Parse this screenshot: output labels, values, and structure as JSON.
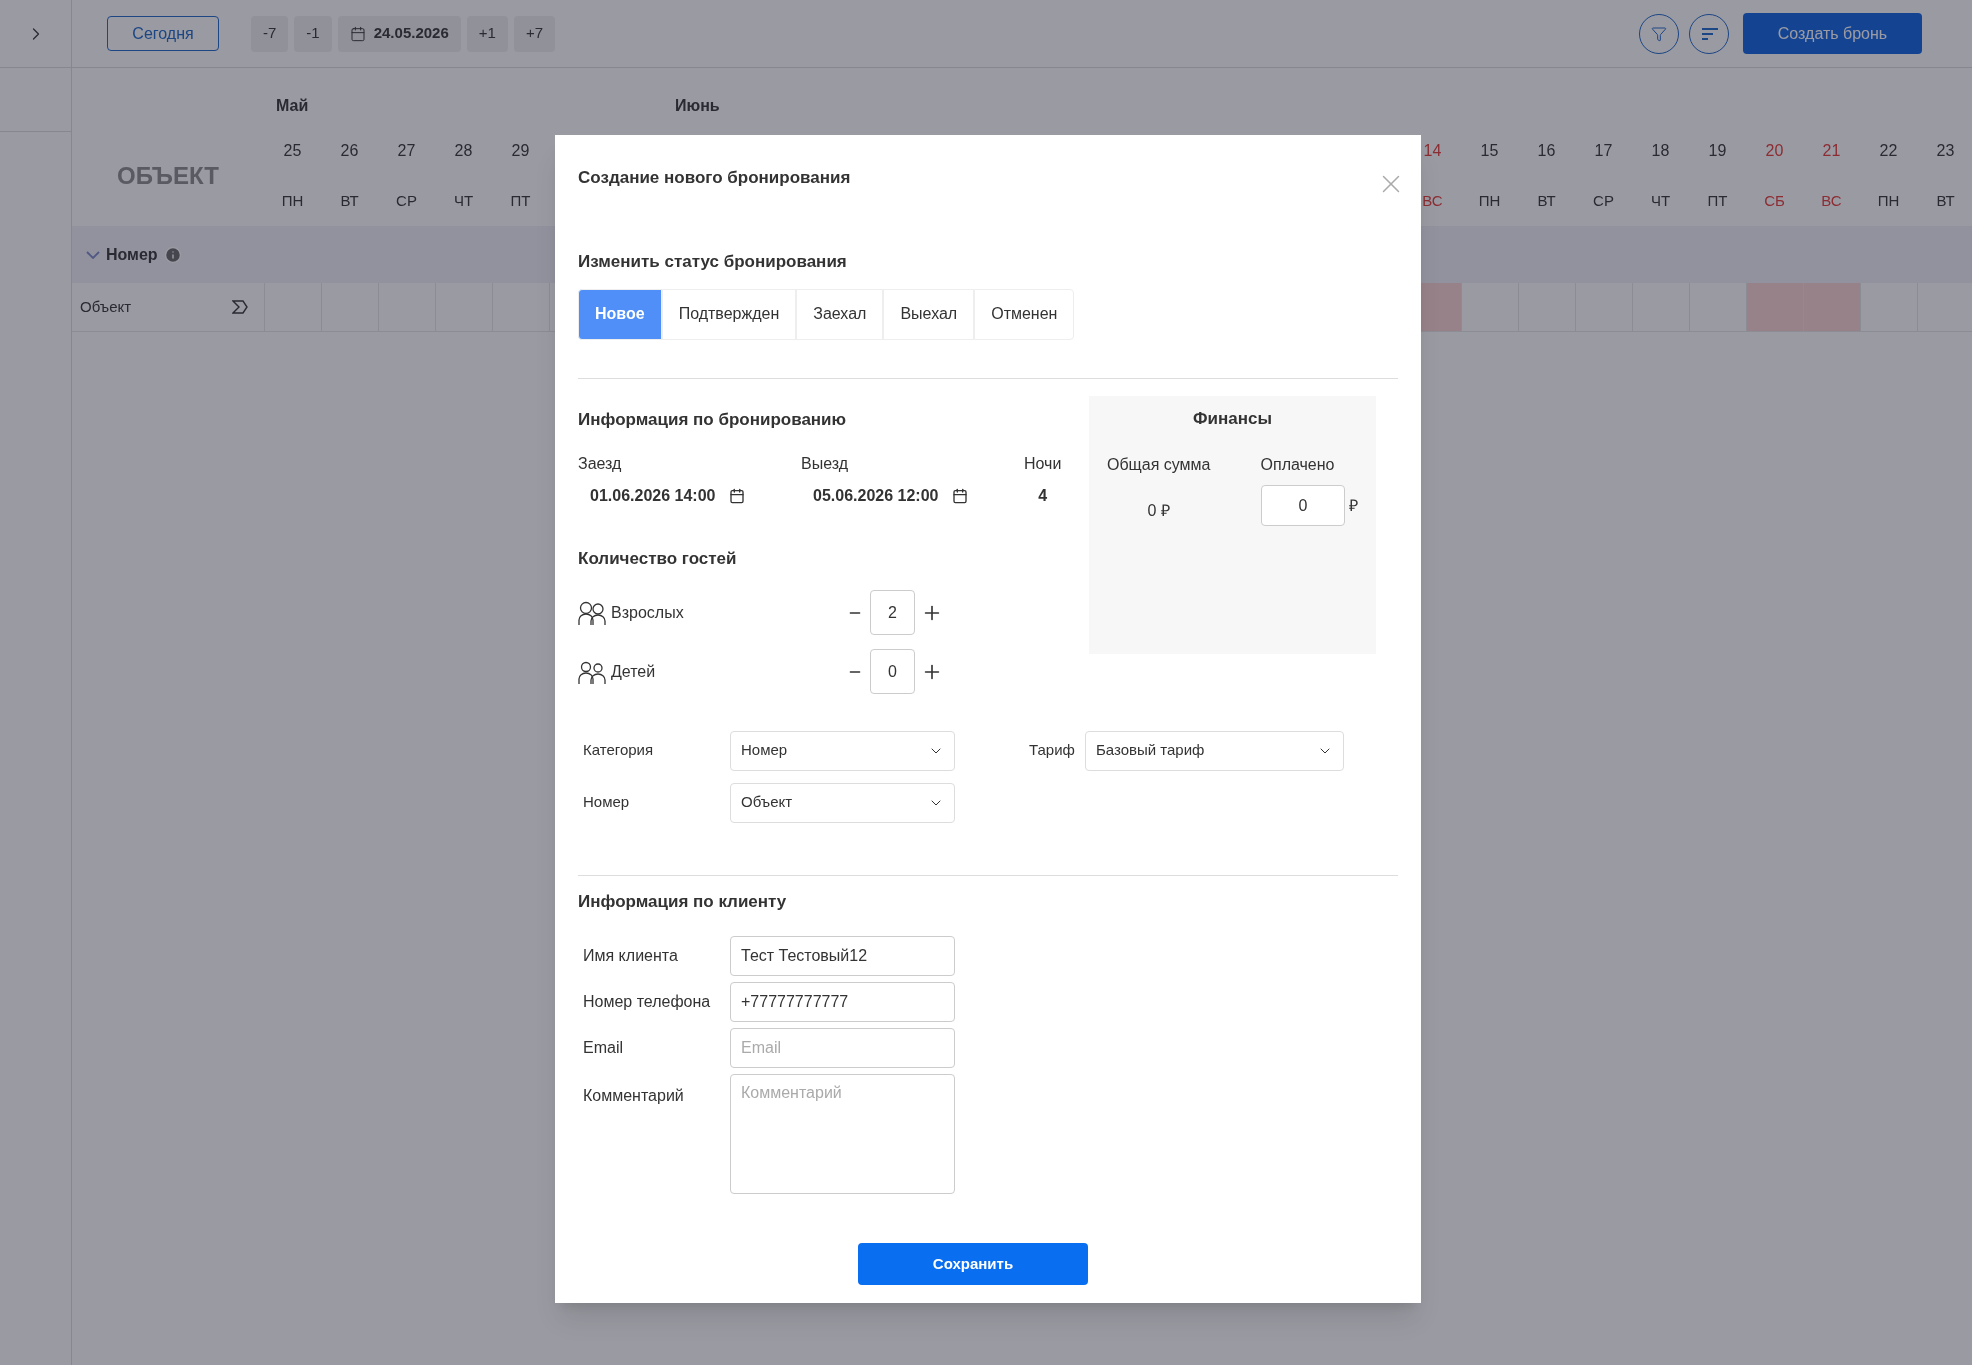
{
  "toolbar": {
    "today_button": "Сегодня",
    "steps_before": [
      "-7",
      "-1"
    ],
    "date": "24.05.2026",
    "steps_after": [
      "+1",
      "+7"
    ],
    "create_button": "Создать бронь"
  },
  "calendar": {
    "object_heading": "ОБЪЕКТ",
    "months": [
      "Май",
      "Июнь"
    ],
    "left_days": [
      {
        "day": "25",
        "weekday": "ПН",
        "weekend": false
      },
      {
        "day": "26",
        "weekday": "ВТ",
        "weekend": false
      },
      {
        "day": "27",
        "weekday": "СР",
        "weekend": false
      },
      {
        "day": "28",
        "weekday": "ЧТ",
        "weekend": false
      },
      {
        "day": "29",
        "weekday": "ПТ",
        "weekend": false
      }
    ],
    "right_days": [
      {
        "day": "14",
        "weekday": "ВС",
        "weekend": true
      },
      {
        "day": "15",
        "weekday": "ПН",
        "weekend": false
      },
      {
        "day": "16",
        "weekday": "ВТ",
        "weekend": false
      },
      {
        "day": "17",
        "weekday": "СР",
        "weekend": false
      },
      {
        "day": "18",
        "weekday": "ЧТ",
        "weekend": false
      },
      {
        "day": "19",
        "weekday": "ПТ",
        "weekend": false
      },
      {
        "day": "20",
        "weekday": "СБ",
        "weekend": true
      },
      {
        "day": "21",
        "weekday": "ВС",
        "weekend": true
      },
      {
        "day": "22",
        "weekday": "ПН",
        "weekend": false
      },
      {
        "day": "23",
        "weekday": "ВТ",
        "weekend": false
      }
    ],
    "group": {
      "label": "Номер",
      "expanded": true
    },
    "rows": [
      {
        "name": "Объект"
      }
    ]
  },
  "modal": {
    "title": "Создание нового бронирования",
    "status": {
      "heading": "Изменить статус бронирования",
      "options": [
        {
          "label": "Новое",
          "selected": true
        },
        {
          "label": "Подтвержден",
          "selected": false
        },
        {
          "label": "Заехал",
          "selected": false
        },
        {
          "label": "Выехал",
          "selected": false
        },
        {
          "label": "Отменен",
          "selected": false
        }
      ]
    },
    "booking": {
      "heading": "Информация по бронированию",
      "check_in": {
        "label": "Заезд",
        "value": "01.06.2026 14:00"
      },
      "check_out": {
        "label": "Выезд",
        "value": "05.06.2026 12:00"
      },
      "nights": {
        "label": "Ночи",
        "value": "4"
      }
    },
    "finance": {
      "heading": "Финансы",
      "total_label": "Общая сумма",
      "total_value": "0 ₽",
      "paid_label": "Оплачено",
      "paid_value": "0",
      "currency": "₽"
    },
    "guests": {
      "heading": "Количество гостей",
      "items": [
        {
          "label": "Взрослых",
          "value": "2"
        },
        {
          "label": "Детей",
          "value": "0"
        }
      ]
    },
    "selects": [
      {
        "label": "Категория",
        "value": "Номер"
      },
      {
        "label": "Номер",
        "value": "Объект"
      }
    ],
    "tariff": {
      "label": "Тариф",
      "value": "Базовый тариф"
    },
    "client": {
      "heading": "Информация по клиенту",
      "fields": [
        {
          "kind": "input",
          "label": "Имя клиента",
          "value": "Тест Тестовый12"
        },
        {
          "kind": "input",
          "label": "Номер телефона",
          "value": "+77777777777"
        },
        {
          "kind": "input",
          "label": "Email",
          "placeholder": "Email"
        },
        {
          "kind": "textarea",
          "label": "Комментарий",
          "placeholder": "Комментарий"
        }
      ]
    },
    "save_button": "Сохранить"
  }
}
